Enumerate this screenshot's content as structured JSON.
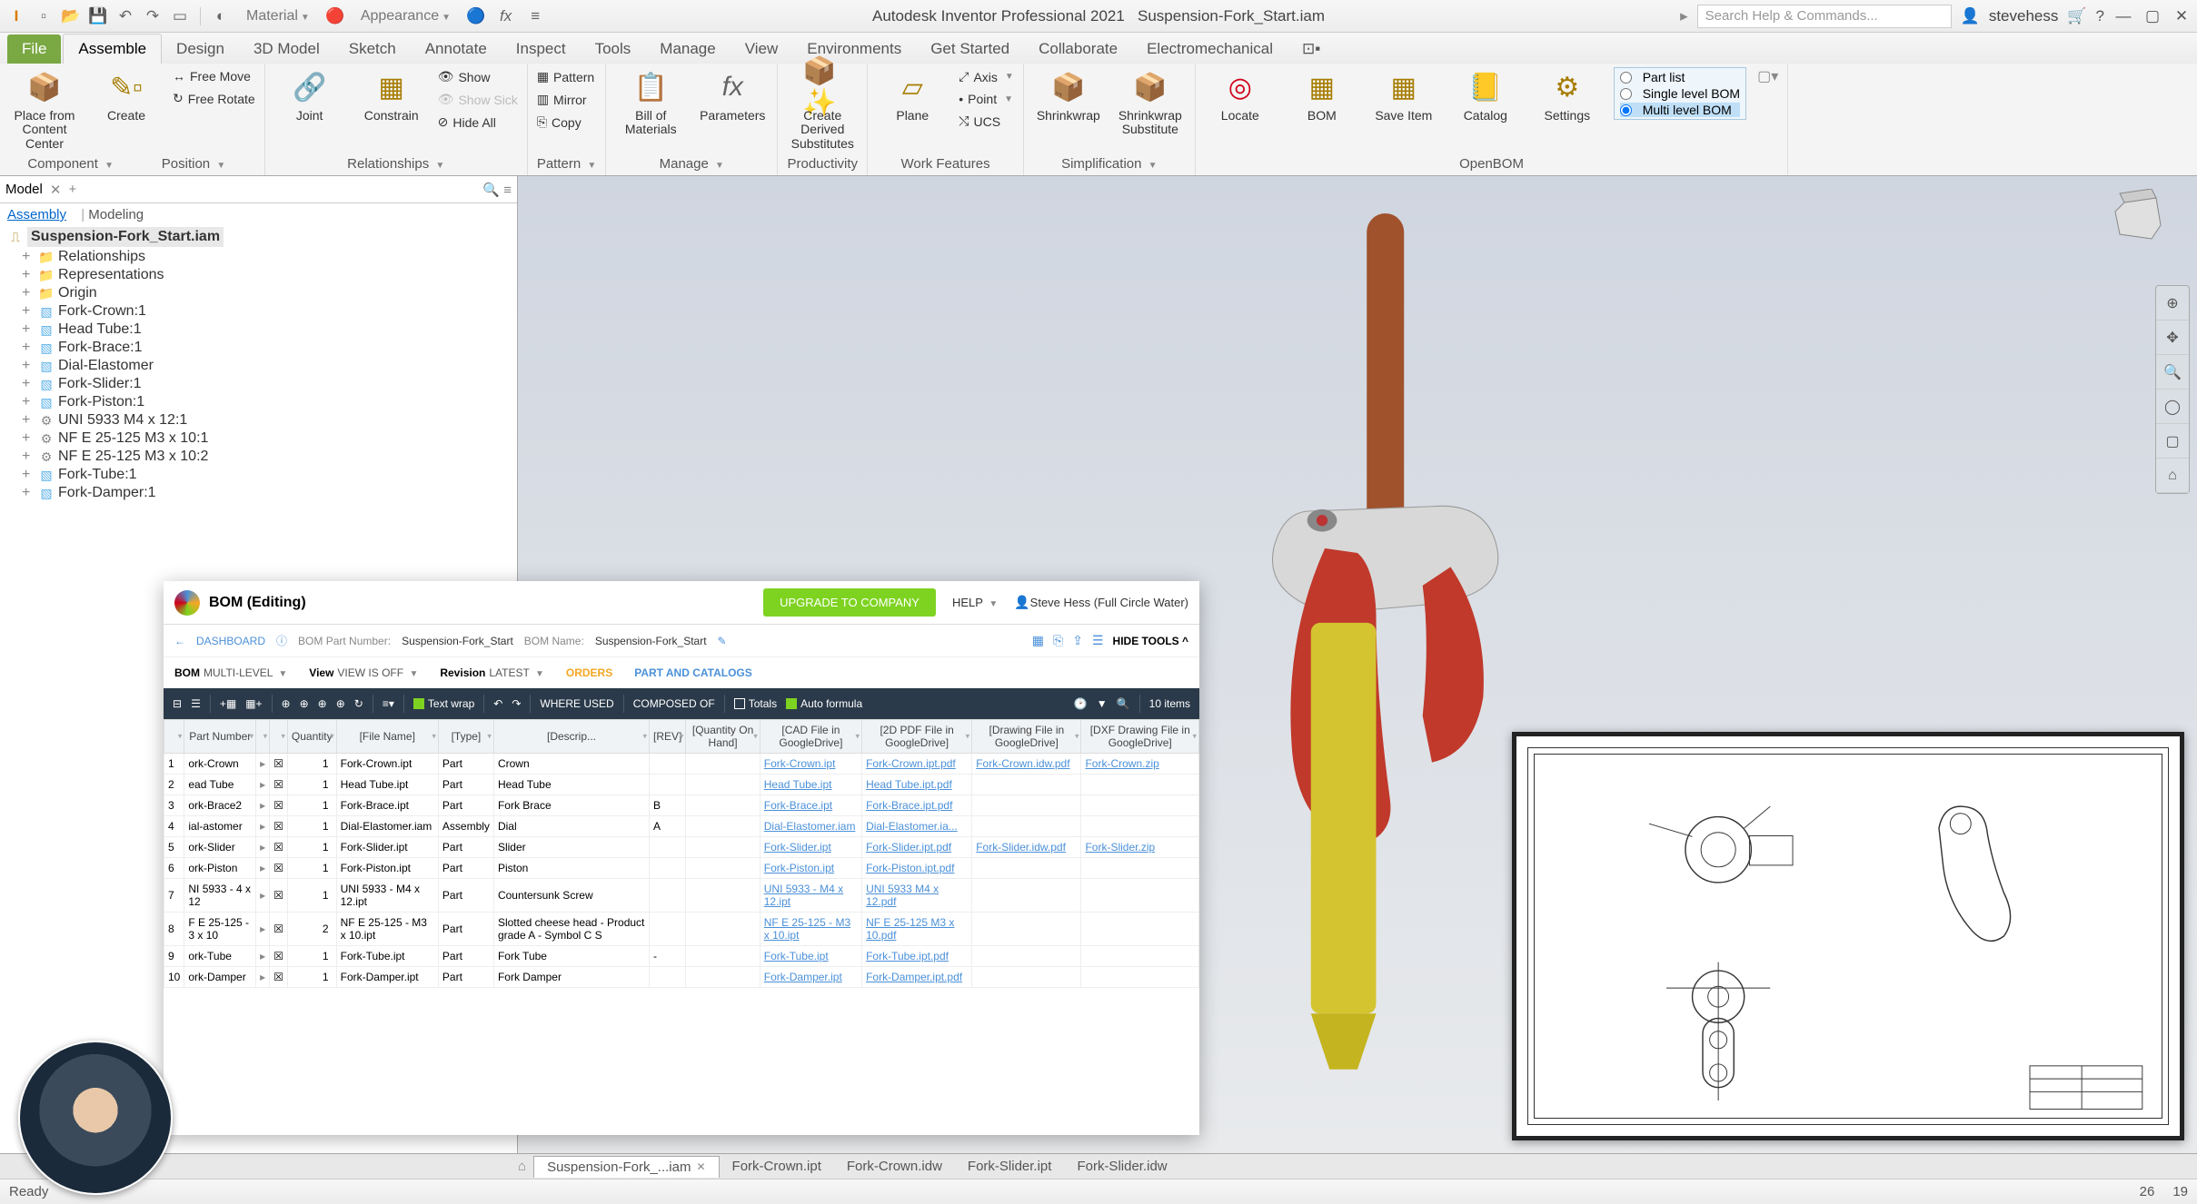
{
  "titlebar": {
    "app_title": "Autodesk Inventor Professional 2021",
    "doc_title": "Suspension-Fork_Start.iam",
    "material_label": "Material",
    "appearance_label": "Appearance",
    "search_placeholder": "Search Help & Commands...",
    "username": "stevehess"
  },
  "ribbon": {
    "file_tab": "File",
    "tabs": [
      "Assemble",
      "Design",
      "3D Model",
      "Sketch",
      "Annotate",
      "Inspect",
      "Tools",
      "Manage",
      "View",
      "Environments",
      "Get Started",
      "Collaborate",
      "Electromechanical"
    ],
    "active_tab": "Assemble",
    "component": {
      "place": "Place from Content Center",
      "create": "Create",
      "label": "Component",
      "free_move": "Free Move",
      "free_rotate": "Free Rotate"
    },
    "position": {
      "label": "Position"
    },
    "relationships": {
      "joint": "Joint",
      "constrain": "Constrain",
      "show": "Show",
      "show_sick": "Show Sick",
      "hide_all": "Hide All",
      "label": "Relationships"
    },
    "pattern": {
      "pattern": "Pattern",
      "mirror": "Mirror",
      "copy": "Copy",
      "label": "Pattern"
    },
    "manage": {
      "bom": "Bill of Materials",
      "parameters": "Parameters",
      "label": "Manage"
    },
    "productivity": {
      "create_derived": "Create Derived Substitutes",
      "label": "Productivity"
    },
    "work_features": {
      "plane": "Plane",
      "axis": "Axis",
      "point": "Point",
      "ucs": "UCS",
      "label": "Work Features"
    },
    "simplification": {
      "shrinkwrap": "Shrinkwrap",
      "shrinkwrap_sub": "Shrinkwrap Substitute",
      "label": "Simplification"
    },
    "openbom": {
      "locate": "Locate",
      "bom": "BOM",
      "save": "Save Item",
      "catalog": "Catalog",
      "settings": "Settings",
      "part_list": "Part list",
      "single": "Single level BOM",
      "multi": "Multi level BOM",
      "label": "OpenBOM"
    }
  },
  "browser": {
    "panel_label": "Model",
    "tabs": {
      "assembly": "Assembly",
      "modeling": "Modeling"
    },
    "root": "Suspension-Fork_Start.iam",
    "folders": [
      "Relationships",
      "Representations",
      "Origin"
    ],
    "parts": [
      "Fork-Crown:1",
      "Head Tube:1",
      "Fork-Brace:1",
      "Dial-Elastomer",
      "Fork-Slider:1",
      "Fork-Piston:1",
      "UNI 5933 M4 x 12:1",
      "NF E 25-125 M3 x 10:1",
      "NF E 25-125 M3 x 10:2",
      "Fork-Tube:1",
      "Fork-Damper:1"
    ]
  },
  "bom": {
    "title": "BOM (Editing)",
    "upgrade": "UPGRADE TO COMPANY",
    "help": "HELP",
    "user": "Steve Hess (Full Circle Water)",
    "dashboard": "DASHBOARD",
    "pn_label": "BOM Part Number:",
    "pn_value": "Suspension-Fork_Start",
    "name_label": "BOM Name:",
    "name_value": "Suspension-Fork_Start",
    "hide_tools": "HIDE TOOLS",
    "filters": {
      "bom_k": "BOM",
      "bom_v": "MULTI-LEVEL",
      "view_k": "View",
      "view_v": "VIEW IS OFF",
      "rev_k": "Revision",
      "rev_v": "LATEST",
      "orders": "ORDERS",
      "catalogs": "PART AND CATALOGS"
    },
    "toolbar": {
      "text_wrap": "Text wrap",
      "where_used": "WHERE USED",
      "composed_of": "COMPOSED OF",
      "totals": "Totals",
      "auto_formula": "Auto formula",
      "count": "10 items"
    },
    "columns": [
      "",
      "Part Number",
      "",
      "",
      "Quantity",
      "[File Name]",
      "[Type]",
      "[Descrip...",
      "[REV]",
      "[Quantity On Hand]",
      "[CAD File in GoogleDrive]",
      "[2D PDF File in GoogleDrive]",
      "[Drawing File in GoogleDrive]",
      "[DXF Drawing File in GoogleDrive]"
    ],
    "rows": [
      {
        "n": "1",
        "pn": "ork-Crown",
        "q": "1",
        "fn": "Fork-Crown.ipt",
        "ty": "Part",
        "de": "Crown",
        "rev": "",
        "cad": "Fork-Crown.ipt",
        "pdf": "Fork-Crown.ipt.pdf",
        "drw": "Fork-Crown.idw.pdf",
        "dxf": "Fork-Crown.zip"
      },
      {
        "n": "2",
        "pn": "ead Tube",
        "q": "1",
        "fn": "Head Tube.ipt",
        "ty": "Part",
        "de": "Head Tube",
        "rev": "",
        "cad": "Head Tube.ipt",
        "pdf": "Head Tube.ipt.pdf",
        "drw": "",
        "dxf": ""
      },
      {
        "n": "3",
        "pn": "ork-Brace2",
        "q": "1",
        "fn": "Fork-Brace.ipt",
        "ty": "Part",
        "de": "Fork Brace",
        "rev": "B",
        "cad": "Fork-Brace.ipt",
        "pdf": "Fork-Brace.ipt.pdf",
        "drw": "",
        "dxf": ""
      },
      {
        "n": "4",
        "pn": "ial-astomer",
        "q": "1",
        "fn": "Dial-Elastomer.iam",
        "ty": "Assembly",
        "de": "Dial",
        "rev": "A",
        "cad": "Dial-Elastomer.iam",
        "pdf": "Dial-Elastomer.ia...",
        "drw": "",
        "dxf": ""
      },
      {
        "n": "5",
        "pn": "ork-Slider",
        "q": "1",
        "fn": "Fork-Slider.ipt",
        "ty": "Part",
        "de": "Slider",
        "rev": "",
        "cad": "Fork-Slider.ipt",
        "pdf": "Fork-Slider.ipt.pdf",
        "drw": "Fork-Slider.idw.pdf",
        "dxf": "Fork-Slider.zip"
      },
      {
        "n": "6",
        "pn": "ork-Piston",
        "q": "1",
        "fn": "Fork-Piston.ipt",
        "ty": "Part",
        "de": "Piston",
        "rev": "",
        "cad": "Fork-Piston.ipt",
        "pdf": "Fork-Piston.ipt.pdf",
        "drw": "",
        "dxf": ""
      },
      {
        "n": "7",
        "pn": "NI 5933 - 4 x 12",
        "q": "1",
        "fn": "UNI 5933 - M4 x 12.ipt",
        "ty": "Part",
        "de": "Countersunk Screw",
        "rev": "",
        "cad": "UNI 5933 - M4 x 12.ipt",
        "pdf": "UNI 5933 M4 x 12.pdf",
        "drw": "",
        "dxf": ""
      },
      {
        "n": "8",
        "pn": "F E 25-125 - 3 x 10",
        "q": "2",
        "fn": "NF E 25-125 - M3 x 10.ipt",
        "ty": "Part",
        "de": "Slotted cheese head - Product grade A - Symbol C S",
        "rev": "",
        "cad": "NF E 25-125 - M3 x 10.ipt",
        "pdf": "NF E 25-125 M3 x 10.pdf",
        "drw": "",
        "dxf": ""
      },
      {
        "n": "9",
        "pn": "ork-Tube",
        "q": "1",
        "fn": "Fork-Tube.ipt",
        "ty": "Part",
        "de": "Fork Tube",
        "rev": "-",
        "cad": "Fork-Tube.ipt",
        "pdf": "Fork-Tube.ipt.pdf",
        "drw": "",
        "dxf": ""
      },
      {
        "n": "10",
        "pn": "ork-Damper",
        "q": "1",
        "fn": "Fork-Damper.ipt",
        "ty": "Part",
        "de": "Fork Damper",
        "rev": "",
        "cad": "Fork-Damper.ipt",
        "pdf": "Fork-Damper.ipt.pdf",
        "drw": "",
        "dxf": ""
      }
    ]
  },
  "doc_tabs": [
    {
      "label": "Suspension-Fork_...iam",
      "active": true,
      "close": true
    },
    {
      "label": "Fork-Crown.ipt",
      "active": false
    },
    {
      "label": "Fork-Crown.idw",
      "active": false
    },
    {
      "label": "Fork-Slider.ipt",
      "active": false
    },
    {
      "label": "Fork-Slider.idw",
      "active": false
    }
  ],
  "statusbar": {
    "left": "Ready",
    "coord1": "26",
    "coord2": "19"
  }
}
